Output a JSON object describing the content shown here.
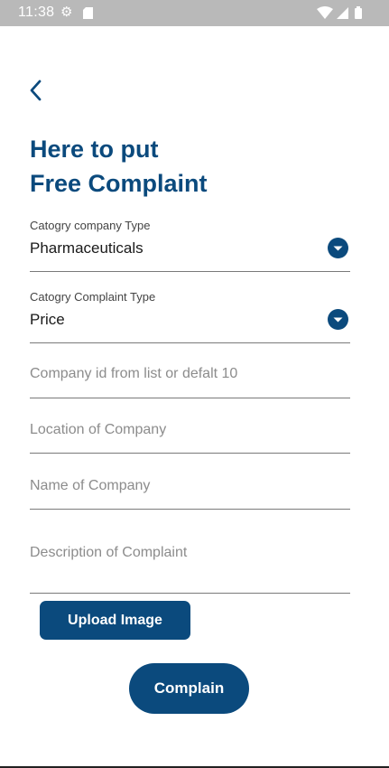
{
  "status_bar": {
    "time": "11:38",
    "icons": [
      "gear-icon",
      "sd-card-icon",
      "wifi-icon",
      "signal-icon",
      "battery-icon"
    ]
  },
  "header": {
    "back_icon": "chevron-left-icon",
    "title_line1": "Here to put",
    "title_line2": "Free Complaint"
  },
  "form": {
    "company_type": {
      "label": "Catogry company Type",
      "value": "Pharmaceuticals",
      "icon": "dropdown-arrow-icon"
    },
    "complaint_type": {
      "label": "Catogry Complaint Type",
      "value": "Price",
      "icon": "dropdown-arrow-icon"
    },
    "company_id": {
      "placeholder": "Company id from list or defalt 10",
      "value": ""
    },
    "location": {
      "placeholder": "Location of Company",
      "value": ""
    },
    "name": {
      "placeholder": "Name of Company",
      "value": ""
    },
    "description": {
      "placeholder": "Description of Complaint",
      "value": ""
    }
  },
  "actions": {
    "upload_label": "Upload Image",
    "complain_label": "Complain"
  },
  "colors": {
    "primary": "#0b4a7d",
    "status_bar": "#b9b9b9",
    "divider": "#7a7a7a",
    "placeholder": "#8c8c8c"
  }
}
